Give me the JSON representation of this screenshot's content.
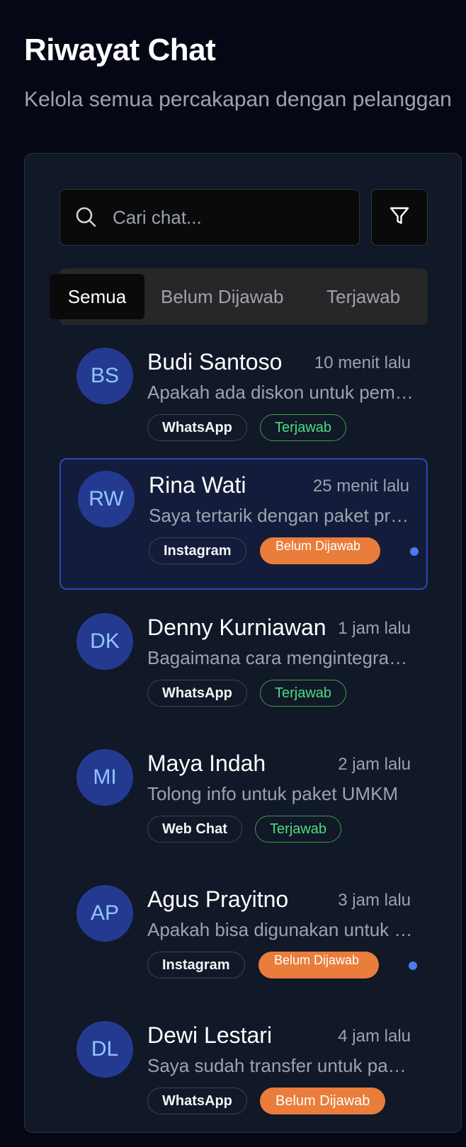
{
  "header": {
    "title": "Riwayat Chat",
    "subtitle": "Kelola semua percakapan dengan pelanggan"
  },
  "search": {
    "placeholder": "Cari chat...",
    "value": ""
  },
  "tabs": [
    {
      "label": "Semua",
      "active": true
    },
    {
      "label": "Belum Dijawab",
      "active": false
    },
    {
      "label": "Terjawab",
      "active": false
    }
  ],
  "chats": [
    {
      "initials": "BS",
      "name": "Budi Santoso",
      "time": "10 menit lalu",
      "preview": "Apakah ada diskon untuk pembelian dalam jumlah banyak?",
      "channel": "WhatsApp",
      "status": "Terjawab",
      "unread": false,
      "selected": false
    },
    {
      "initials": "RW",
      "name": "Rina Wati",
      "time": "25 menit lalu",
      "preview": "Saya tertarik dengan paket premium yang ditawarkan",
      "channel": "Instagram",
      "status": "Belum Dijawab",
      "unread": true,
      "selected": true
    },
    {
      "initials": "DK",
      "name": "Denny Kurniawan",
      "time": "1 jam lalu",
      "preview": "Bagaimana cara mengintegrasikan dengan sistem kami?",
      "channel": "WhatsApp",
      "status": "Terjawab",
      "unread": false,
      "selected": false
    },
    {
      "initials": "MI",
      "name": "Maya Indah",
      "time": "2 jam lalu",
      "preview": "Tolong info untuk paket UMKM",
      "channel": "Web Chat",
      "status": "Terjawab",
      "unread": false,
      "selected": false
    },
    {
      "initials": "AP",
      "name": "Agus Prayitno",
      "time": "3 jam lalu",
      "preview": "Apakah bisa digunakan untuk beberapa cabang?",
      "channel": "Instagram",
      "status": "Belum Dijawab",
      "unread": true,
      "selected": false
    },
    {
      "initials": "DL",
      "name": "Dewi Lestari",
      "time": "4 jam lalu",
      "preview": "Saya sudah transfer untuk paket tahunan",
      "channel": "WhatsApp",
      "status": "Belum Dijawab",
      "unread": false,
      "selected": false
    }
  ],
  "colors": {
    "background": "#050814",
    "panel": "#111827",
    "avatar": "#243a91",
    "answered": "#3f9b4f",
    "unanswered": "#ea7d3b",
    "unread_dot": "#4b7bf0",
    "selected_border": "#2b46b8"
  }
}
